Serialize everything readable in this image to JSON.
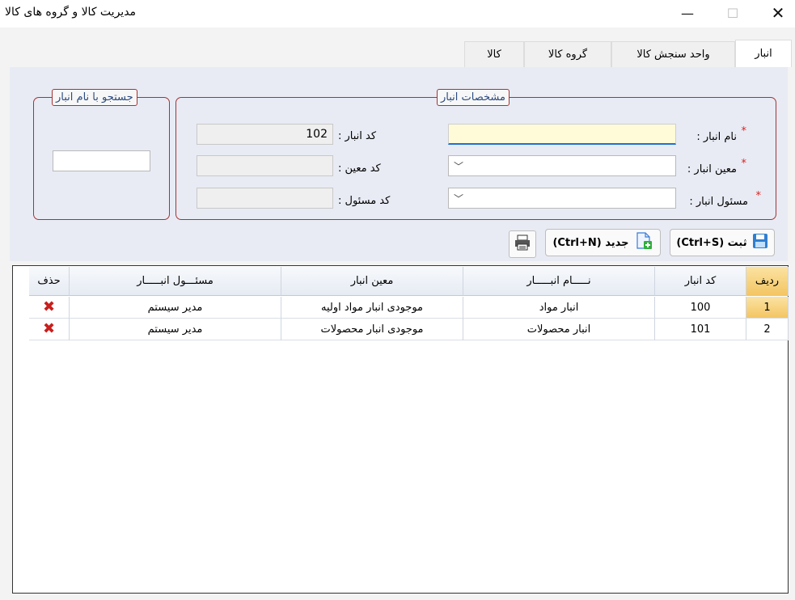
{
  "window": {
    "title": "مدیریت کالا و گروه های کالا",
    "controls": {
      "minimize": "—",
      "maximize": "☐",
      "close": "✕"
    }
  },
  "tabs": [
    {
      "label": "انبار",
      "active": true
    },
    {
      "label": "واحد سنجش کالا",
      "active": false
    },
    {
      "label": "گروه کالا",
      "active": false
    },
    {
      "label": "کالا",
      "active": false
    }
  ],
  "warehouse_group": {
    "legend": "مشخصات انبار",
    "name_label": "نام انبار :",
    "name_value": "",
    "moein_label": "معین انبار :",
    "moein_value": "",
    "responsible_label": "مسئول انبار :",
    "responsible_value": "",
    "required_mark": "*",
    "code_label": "کد انبار :",
    "code_value": "102",
    "moein_code_label": "کد معین :",
    "moein_code_value": "",
    "responsible_code_label": "کد مسئول :",
    "responsible_code_value": ""
  },
  "search_group": {
    "legend": "جستجو با نام انبار",
    "search_value": ""
  },
  "toolbar": {
    "save_label": "ثبت (Ctrl+S)",
    "new_label": "جدید (Ctrl+N)",
    "icons": [
      "save-icon",
      "new-file-icon",
      "print-icon"
    ]
  },
  "table": {
    "columns": [
      "ردیف",
      "کد انبار",
      "نـــــام انبـــــار",
      "معین انبار",
      "مسئـــول انبـــــار",
      "حذف"
    ],
    "rows": [
      {
        "row_no": "1",
        "code": "100",
        "name": "انبار مواد",
        "moein": "موجودی انبار مواد اولیه",
        "responsible": "مدیر سیستم"
      },
      {
        "row_no": "2",
        "code": "101",
        "name": "انبار محصولات",
        "moein": "موجودی انبار محصولات",
        "responsible": "مدیر سیستم"
      }
    ],
    "selected_row": 1
  },
  "colors": {
    "group_border": "#a33434",
    "legend_text": "#2a4a80",
    "selected_row_header": "#f3c563",
    "required_star": "#dd2222",
    "delete_icon": "#c8201d"
  }
}
